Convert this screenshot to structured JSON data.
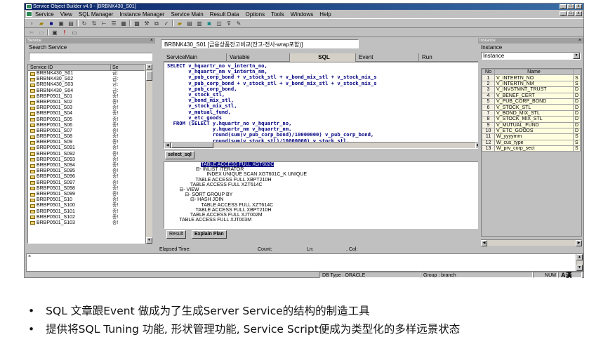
{
  "window": {
    "title": "Service Object Builder v4.0 - [BRBNK430_S01]",
    "win_minimize": "_",
    "win_maximize": "□",
    "win_close": "x"
  },
  "menu": [
    {
      "label": "Service",
      "u": "S"
    },
    {
      "label": "View",
      "u": "V"
    },
    {
      "label": "SQL Manager",
      "u": "Q"
    },
    {
      "label": "Instance Manager",
      "u": "I"
    },
    {
      "label": "Service Main",
      "u": "M"
    },
    {
      "label": "Result Data",
      "u": "R"
    },
    {
      "label": "Options",
      "u": "O"
    },
    {
      "label": "Tools",
      "u": "T"
    },
    {
      "label": "Windows",
      "u": "W"
    },
    {
      "label": "Help",
      "u": "H"
    }
  ],
  "left_panel": {
    "caption": "Service",
    "title": "Search Service",
    "search_value": "",
    "col_id": "Service ID",
    "col_name": "Se",
    "items": [
      {
        "id": "BRBNK430_S01",
        "name": "금:"
      },
      {
        "id": "BRBNK430_S02",
        "name": "금:"
      },
      {
        "id": "BRBNK430_S03",
        "name": "금:"
      },
      {
        "id": "BRBNK430_S04",
        "name": "금:"
      },
      {
        "id": "BRBP0501_S01",
        "name": "종!"
      },
      {
        "id": "BRBP0501_S02",
        "name": "종!"
      },
      {
        "id": "BRBP0501_S03",
        "name": "종!"
      },
      {
        "id": "BRBP0501_S04",
        "name": "종!"
      },
      {
        "id": "BRBP0501_S05",
        "name": "종!"
      },
      {
        "id": "BRBP0501_S06",
        "name": "종!"
      },
      {
        "id": "BRBP0501_S07",
        "name": "종!"
      },
      {
        "id": "BRBP0501_S08",
        "name": "종!"
      },
      {
        "id": "BRBP0501_S09",
        "name": "종!"
      },
      {
        "id": "BRBP0501_S091",
        "name": "종!"
      },
      {
        "id": "BRBP0501_S092",
        "name": "종!"
      },
      {
        "id": "BRBP0501_S093",
        "name": "종!"
      },
      {
        "id": "BRBP0501_S094",
        "name": "종!"
      },
      {
        "id": "BRBP0501_S095",
        "name": "종!"
      },
      {
        "id": "BRBP0501_S096",
        "name": "종!"
      },
      {
        "id": "BRBP0501_S097",
        "name": "종!"
      },
      {
        "id": "BRBP0501_S098",
        "name": "종!"
      },
      {
        "id": "BRBP0501_S099",
        "name": "종!"
      },
      {
        "id": "BRBP0501_S10",
        "name": "종!"
      },
      {
        "id": "BRBP0501_S100",
        "name": "종!"
      },
      {
        "id": "BRBP0501_S101",
        "name": "종!"
      },
      {
        "id": "BRBP0501_S102",
        "name": "종!"
      },
      {
        "id": "BRBP0501_S103",
        "name": "종!"
      }
    ]
  },
  "center": {
    "doc_tab": "BRBNK430_S01 [금융상품잔고비교(잔고-전사-wrap포함)]",
    "subtabs": [
      "ServiceMain",
      "Variable",
      "SQL",
      "Event",
      "Run"
    ],
    "active_subtab": "SQL",
    "sql_lines": [
      "SELECT v_hquartr_no v_intertn_no,",
      "       v_hquartr_nm v_intertn_nm,",
      "       v_pub_corp_bond + v_stock_stl + v_bond_mix_stl + v_stock_mix_s",
      "       v_pub_corp_bond + v_stock_stl + v_bond_mix_stl + v_stock_mix_s",
      "       v_pub_corp_bond,",
      "       v_stock_stl,",
      "       v_bond_mix_stl,",
      "       v_stock_mix_stl,",
      "       v_mutual_fund,",
      "       v_etc_goods",
      "  FROM (SELECT y.hquartr_no v_hquartr_no,",
      "               y.hquartr_nm v_hquartr_nm,",
      "               round(sum(v_pub_corp_bond)/10000000) v_pub_corp_bond,",
      "               round(sum(v_stock_stl)/10000000) v_stock_stl,"
    ],
    "select_tab": "select_sql",
    "plan_lines": [
      {
        "text": "                          TABLE ACCESS FULL XGT602C",
        "hl": true
      },
      {
        "text": "                      ⊟- INLIST ITERATOR",
        "hl": false
      },
      {
        "text": "                              INDEX UNIQUE SCAN XGT601C_K UNIQUE",
        "hl": false
      },
      {
        "text": "                      TABLE ACCESS FULL XBPT210H",
        "hl": false
      },
      {
        "text": "                  TABLE ACCESS FULL XZT614C",
        "hl": false
      },
      {
        "text": "          ⊟- VIEW",
        "hl": false
      },
      {
        "text": "              ⊟- SORT GROUP BY",
        "hl": false
      },
      {
        "text": "                  ⊟- HASH JOIN",
        "hl": false
      },
      {
        "text": "                          TABLE ACCESS FULL XZT614C",
        "hl": false
      },
      {
        "text": "                      TABLE ACCESS FULL XBPT210H",
        "hl": false
      },
      {
        "text": "                  TABLE ACCESS FULL XJT002M",
        "hl": false
      },
      {
        "text": "          TABLE ACCESS FULL XJT003M",
        "hl": false
      }
    ],
    "bottom_tabs": [
      "Result",
      "Explain Plan"
    ],
    "status": {
      "elapsed": "Elapsed Time:",
      "count": "Count:",
      "ln": "Ln:",
      "col": ", Col:"
    }
  },
  "right_panel": {
    "caption": "Instance",
    "title": "Instance",
    "select_value": "Instance",
    "col_no": "No",
    "col_name": "Name",
    "rows": [
      {
        "no": "1",
        "name": "V_INTERTN_NO",
        "t": "S"
      },
      {
        "no": "2",
        "name": "V_INTERTN_NM",
        "t": "S"
      },
      {
        "no": "3",
        "name": "V_INVSTMNT_TRUST",
        "t": "D"
      },
      {
        "no": "4",
        "name": "V_BENEF_CERT",
        "t": "D"
      },
      {
        "no": "5",
        "name": "V_PUB_CORP_BOND",
        "t": "D"
      },
      {
        "no": "6",
        "name": "V_STOCK_STL",
        "t": "D"
      },
      {
        "no": "7",
        "name": "V_BOND_MIX_STL",
        "t": "D"
      },
      {
        "no": "8",
        "name": "V_STOCK_MIX_STL",
        "t": "D"
      },
      {
        "no": "9",
        "name": "V_MUTUAL_FUND",
        "t": "D"
      },
      {
        "no": "10",
        "name": "V_ETC_GOODS",
        "t": "D"
      },
      {
        "no": "11",
        "name": "W_yyyymm",
        "t": "S"
      },
      {
        "no": "12",
        "name": "W_cus_type",
        "t": "S"
      },
      {
        "no": "13",
        "name": "W_prv_corp_sect",
        "t": "S"
      }
    ]
  },
  "bottom_status": {
    "db_type": "DB Type : ORACLE",
    "group": "Group : branch",
    "num": "NUM",
    "ime": "A漢"
  },
  "bullets": [
    "SQL 文章跟Event 做成为了生成Server Service的结构的制造工具",
    "提供将SQL Tuning 功能, 形状管理功能, Service Script便成为类型化的多样远景状态"
  ]
}
